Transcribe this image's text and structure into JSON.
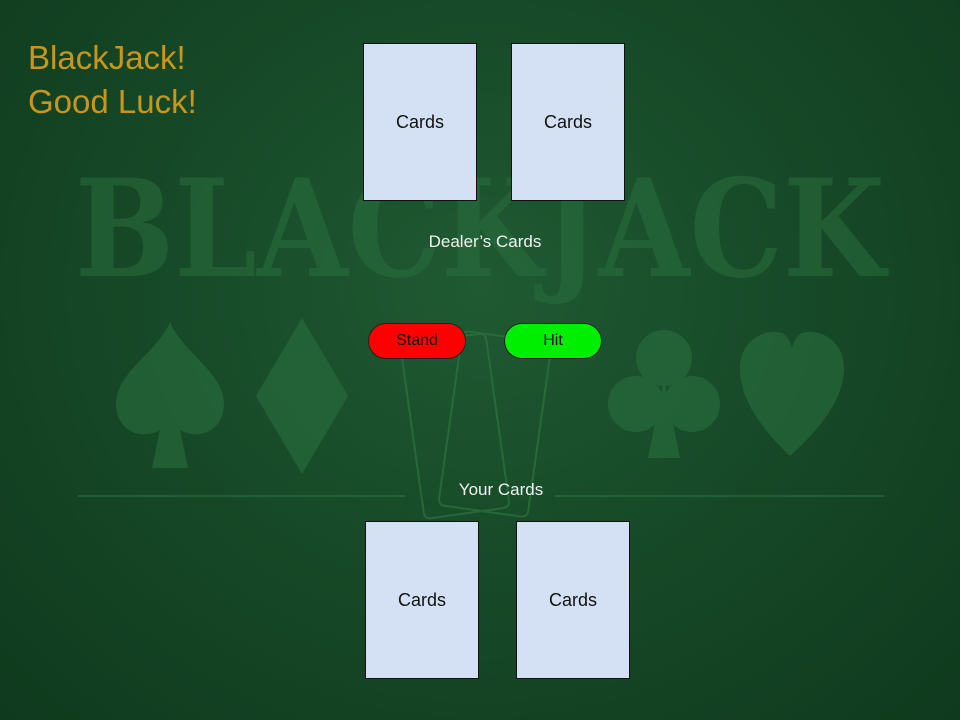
{
  "greeting": {
    "line1": "BlackJack!",
    "line2": "Good Luck!"
  },
  "background": {
    "watermark": "BLACKJACK"
  },
  "dealer": {
    "label": "Dealer’s Cards",
    "cards": [
      "Cards",
      "Cards"
    ]
  },
  "player": {
    "label": "Your Cards",
    "cards": [
      "Cards",
      "Cards"
    ]
  },
  "actions": {
    "stand": {
      "label": "Stand",
      "color": "#ff0000"
    },
    "hit": {
      "label": "Hit",
      "color": "#00ee00"
    }
  },
  "colors": {
    "felt": "#174a28",
    "title_text": "#c8961c",
    "card_face": "#d4e1f4"
  }
}
